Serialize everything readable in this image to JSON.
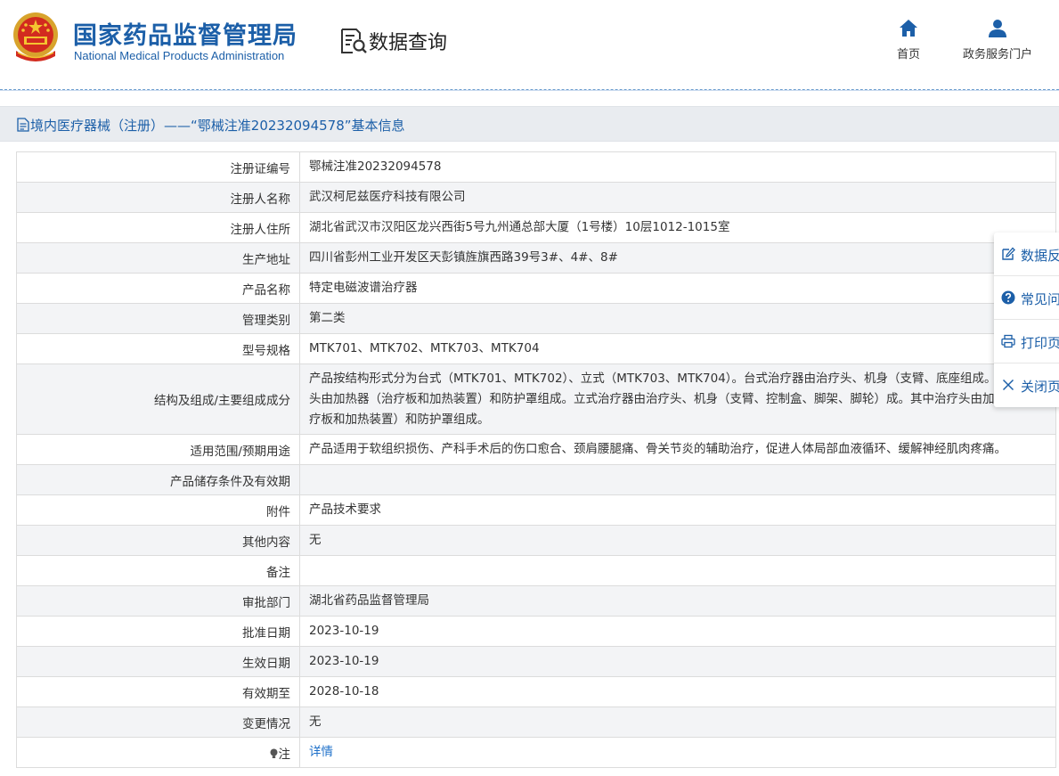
{
  "header": {
    "brand_cn": "国家药品监督管理局",
    "brand_en": "National Medical Products Administration",
    "query_title": "数据查询",
    "nav": [
      {
        "label": "首页",
        "icon": "home-icon"
      },
      {
        "label": "政务服务门户",
        "icon": "user-icon"
      }
    ]
  },
  "page_title": "境内医疗器械（注册）——“鄂械注准20232094578”基本信息",
  "rows": [
    {
      "label": "注册证编号",
      "value": "鄂械注准20232094578"
    },
    {
      "label": "注册人名称",
      "value": "武汉柯尼兹医疗科技有限公司"
    },
    {
      "label": "注册人住所",
      "value": "湖北省武汉市汉阳区龙兴西街5号九州通总部大厦（1号楼）10层1012-1015室"
    },
    {
      "label": "生产地址",
      "value": "四川省彭州工业开发区天彭镇旌旗西路39号3#、4#、8#"
    },
    {
      "label": "产品名称",
      "value": "特定电磁波谱治疗器"
    },
    {
      "label": "管理类别",
      "value": "第二类"
    },
    {
      "label": "型号规格",
      "value": "MTK701、MTK702、MTK703、MTK704"
    },
    {
      "label": "结构及组成/主要组成成分",
      "value": "产品按结构形式分为台式（MTK701、MTK702）、立式（MTK703、MTK704）。台式治疗器由治疗头、机身（支臂、底座组成。其中治疗头由加热器（治疗板和加热装置）和防护罩组成。立式治疗器由治疗头、机身（支臂、控制盒、脚架、脚轮）成。其中治疗头由加热器（治疗板和加热装置）和防护罩组成。"
    },
    {
      "label": "适用范围/预期用途",
      "value": "产品适用于软组织损伤、产科手术后的伤口愈合、颈肩腰腿痛、骨关节炎的辅助治疗，促进人体局部血液循环、缓解神经肌肉疼痛。"
    },
    {
      "label": "产品储存条件及有效期",
      "value": ""
    },
    {
      "label": "附件",
      "value": "产品技术要求"
    },
    {
      "label": "其他内容",
      "value": "无"
    },
    {
      "label": "备注",
      "value": ""
    },
    {
      "label": "审批部门",
      "value": "湖北省药品监督管理局"
    },
    {
      "label": "批准日期",
      "value": "2023-10-19"
    },
    {
      "label": "生效日期",
      "value": "2023-10-19"
    },
    {
      "label": "有效期至",
      "value": "2028-10-18"
    },
    {
      "label": "变更情况",
      "value": "无"
    },
    {
      "label": "注",
      "value": "详情"
    }
  ],
  "side_panel": [
    {
      "label": "数据反",
      "icon": "edit-icon"
    },
    {
      "label": "常见问",
      "icon": "question-icon"
    },
    {
      "label": "打印页",
      "icon": "print-icon"
    },
    {
      "label": "关闭页",
      "icon": "close-icon"
    }
  ]
}
